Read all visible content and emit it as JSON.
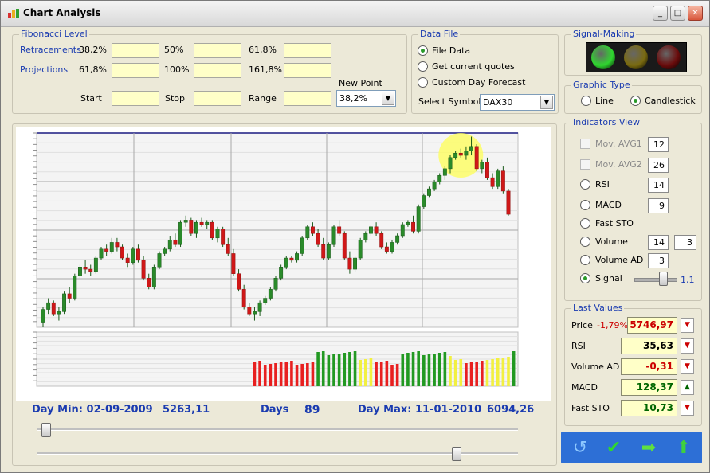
{
  "window": {
    "title": "Chart Analysis",
    "min_label": "_",
    "max_label": "□",
    "close_label": "✕"
  },
  "fibonacci": {
    "group_label": "Fibonacci Level",
    "retracements_label": "Retracements",
    "projections_label": "Projections",
    "ret_1": "38,2%",
    "ret_2": "50%",
    "ret_3": "61,8%",
    "proj_1": "61,8%",
    "proj_2": "100%",
    "proj_3": "161,8%",
    "start_label": "Start",
    "stop_label": "Stop",
    "range_label": "Range",
    "new_point_label": "New Point",
    "new_point_value": "38,2%"
  },
  "data_file": {
    "group_label": "Data File",
    "options": [
      "File Data",
      "Get current quotes",
      "Custom Day Forecast"
    ],
    "selected": 0,
    "symbol_label": "Select Symbol",
    "symbol_value": "DAX30"
  },
  "signal_making": {
    "group_label": "Signal-Making",
    "lights": [
      "#2fd62f",
      "#7a6a10",
      "#6a0c0c"
    ]
  },
  "graphic_type": {
    "group_label": "Graphic Type",
    "line_label": "Line",
    "candlestick_label": "Candlestick",
    "selected": "candlestick"
  },
  "indicators": {
    "group_label": "Indicators View",
    "mov_avg1_label": "Mov. AVG1",
    "mov_avg1_value": "12",
    "mov_avg2_label": "Mov. AVG2",
    "mov_avg2_value": "26",
    "rsi_label": "RSI",
    "rsi_value": "14",
    "macd_label": "MACD",
    "macd_value": "9",
    "fast_sto_label": "Fast STO",
    "volume_label": "Volume",
    "volume_value": "14",
    "volume_value2": "3",
    "volume_ad_label": "Volume AD",
    "volume_ad_value": "3",
    "signal_label": "Signal",
    "signal_value": "1,1",
    "signal_slider_fraction": 0.68
  },
  "last_values": {
    "group_label": "Last Values",
    "price_label": "Price",
    "price_change": "-1,79%",
    "price_value": "5746,97",
    "rsi_label": "RSI",
    "rsi_value": "35,63",
    "volume_ad_label": "Volume AD",
    "volume_ad_value": "-0,31",
    "macd_label": "MACD",
    "macd_value": "128,37",
    "fast_sto_label": "Fast STO",
    "fast_sto_value": "10,73",
    "colors": {
      "negative": "#cc0000",
      "positive": "#006600"
    }
  },
  "chart_info": {
    "day_min_label": "Day Min: 02-09-2009",
    "day_min_value": "5263,11",
    "days_label": "Days",
    "days_value": "89",
    "day_max_label": "Day Max: 11-01-2010",
    "day_max_value": "6094,26"
  },
  "sliders": {
    "top_fraction": 0.0,
    "bottom_fraction": 0.92
  },
  "chart_data": {
    "type": "candlestick",
    "ylim": [
      5240,
      6110
    ],
    "ohlc": [
      [
        5263,
        5330,
        5240,
        5320
      ],
      [
        5320,
        5370,
        5300,
        5350
      ],
      [
        5350,
        5360,
        5290,
        5300
      ],
      [
        5300,
        5330,
        5270,
        5310
      ],
      [
        5310,
        5400,
        5300,
        5390
      ],
      [
        5390,
        5420,
        5350,
        5370
      ],
      [
        5370,
        5480,
        5360,
        5470
      ],
      [
        5470,
        5520,
        5460,
        5510
      ],
      [
        5510,
        5540,
        5480,
        5500
      ],
      [
        5500,
        5520,
        5470,
        5490
      ],
      [
        5490,
        5560,
        5480,
        5550
      ],
      [
        5550,
        5600,
        5540,
        5590
      ],
      [
        5590,
        5610,
        5560,
        5580
      ],
      [
        5580,
        5640,
        5570,
        5620
      ],
      [
        5620,
        5640,
        5580,
        5600
      ],
      [
        5600,
        5610,
        5540,
        5550
      ],
      [
        5550,
        5570,
        5510,
        5530
      ],
      [
        5530,
        5600,
        5520,
        5590
      ],
      [
        5590,
        5610,
        5530,
        5540
      ],
      [
        5540,
        5560,
        5450,
        5460
      ],
      [
        5460,
        5480,
        5410,
        5420
      ],
      [
        5420,
        5520,
        5410,
        5510
      ],
      [
        5510,
        5580,
        5500,
        5570
      ],
      [
        5570,
        5600,
        5560,
        5590
      ],
      [
        5590,
        5650,
        5580,
        5630
      ],
      [
        5630,
        5660,
        5600,
        5610
      ],
      [
        5610,
        5720,
        5600,
        5710
      ],
      [
        5710,
        5740,
        5690,
        5720
      ],
      [
        5720,
        5730,
        5650,
        5660
      ],
      [
        5660,
        5720,
        5640,
        5710
      ],
      [
        5710,
        5730,
        5690,
        5700
      ],
      [
        5700,
        5720,
        5680,
        5710
      ],
      [
        5710,
        5720,
        5630,
        5640
      ],
      [
        5640,
        5690,
        5620,
        5680
      ],
      [
        5680,
        5690,
        5600,
        5610
      ],
      [
        5610,
        5640,
        5560,
        5570
      ],
      [
        5570,
        5590,
        5470,
        5480
      ],
      [
        5480,
        5500,
        5400,
        5410
      ],
      [
        5410,
        5430,
        5320,
        5330
      ],
      [
        5330,
        5350,
        5290,
        5300
      ],
      [
        5300,
        5330,
        5270,
        5310
      ],
      [
        5310,
        5360,
        5290,
        5350
      ],
      [
        5350,
        5380,
        5340,
        5370
      ],
      [
        5370,
        5420,
        5360,
        5410
      ],
      [
        5410,
        5470,
        5400,
        5460
      ],
      [
        5460,
        5520,
        5450,
        5510
      ],
      [
        5510,
        5560,
        5500,
        5550
      ],
      [
        5550,
        5560,
        5530,
        5540
      ],
      [
        5540,
        5580,
        5530,
        5570
      ],
      [
        5570,
        5650,
        5560,
        5640
      ],
      [
        5640,
        5700,
        5630,
        5690
      ],
      [
        5690,
        5710,
        5650,
        5660
      ],
      [
        5660,
        5680,
        5600,
        5610
      ],
      [
        5610,
        5640,
        5540,
        5550
      ],
      [
        5550,
        5620,
        5540,
        5610
      ],
      [
        5610,
        5700,
        5600,
        5690
      ],
      [
        5690,
        5720,
        5650,
        5660
      ],
      [
        5660,
        5670,
        5540,
        5550
      ],
      [
        5550,
        5580,
        5480,
        5500
      ],
      [
        5500,
        5560,
        5490,
        5550
      ],
      [
        5550,
        5640,
        5540,
        5630
      ],
      [
        5630,
        5670,
        5620,
        5660
      ],
      [
        5660,
        5700,
        5650,
        5690
      ],
      [
        5690,
        5710,
        5650,
        5660
      ],
      [
        5660,
        5670,
        5590,
        5600
      ],
      [
        5600,
        5620,
        5570,
        5580
      ],
      [
        5580,
        5630,
        5570,
        5620
      ],
      [
        5620,
        5660,
        5610,
        5650
      ],
      [
        5650,
        5710,
        5640,
        5700
      ],
      [
        5700,
        5720,
        5690,
        5710
      ],
      [
        5710,
        5740,
        5660,
        5670
      ],
      [
        5670,
        5790,
        5660,
        5780
      ],
      [
        5780,
        5840,
        5770,
        5830
      ],
      [
        5830,
        5870,
        5820,
        5860
      ],
      [
        5860,
        5900,
        5850,
        5890
      ],
      [
        5890,
        5930,
        5880,
        5920
      ],
      [
        5920,
        5960,
        5900,
        5950
      ],
      [
        5950,
        6010,
        5930,
        6000
      ],
      [
        6000,
        6030,
        5990,
        6020
      ],
      [
        6020,
        6040,
        6000,
        6010
      ],
      [
        6010,
        6050,
        5990,
        6030
      ],
      [
        6030,
        6094,
        6010,
        6050
      ],
      [
        6050,
        6060,
        5940,
        5950
      ],
      [
        5950,
        5990,
        5930,
        5980
      ],
      [
        5980,
        6000,
        5900,
        5910
      ],
      [
        5910,
        5930,
        5860,
        5870
      ],
      [
        5870,
        5950,
        5860,
        5940
      ],
      [
        5940,
        5960,
        5840,
        5850
      ],
      [
        5850,
        5860,
        5740,
        5746
      ]
    ],
    "volume_signal": [
      0,
      0,
      0,
      0,
      0,
      0,
      0,
      0,
      0,
      0,
      0,
      0,
      0,
      0,
      0,
      0,
      0,
      0,
      0,
      0,
      0,
      0,
      0,
      0,
      0,
      0,
      0,
      0,
      0,
      0,
      0,
      0,
      0,
      0,
      0,
      0,
      0,
      0,
      0,
      0,
      -1,
      -1,
      -1,
      -1,
      -1,
      -1,
      -1,
      -1,
      -1,
      -1,
      -1,
      -1,
      1,
      1,
      1,
      1,
      1,
      1,
      1,
      1,
      2,
      2,
      2,
      -1,
      -1,
      -1,
      -1,
      -1,
      1,
      1,
      1,
      1,
      1,
      1,
      1,
      1,
      1,
      2,
      2,
      2,
      -1,
      -1,
      -1,
      -1,
      2,
      2,
      2,
      2,
      2,
      1
    ]
  }
}
